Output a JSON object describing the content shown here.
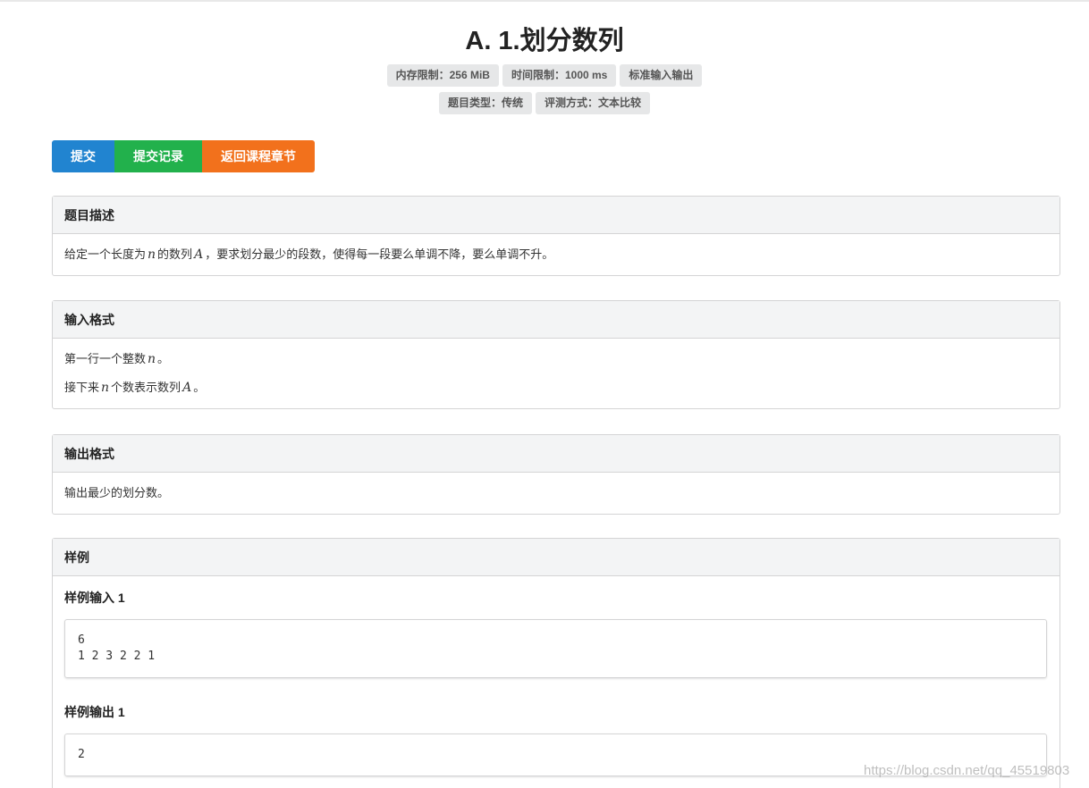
{
  "title": "A. 1.划分数列",
  "tags": {
    "memory": "内存限制：256 MiB",
    "time": "时间限制：1000 ms",
    "io": "标准输入输出",
    "type": "题目类型：传统",
    "judge": "评测方式：文本比较"
  },
  "buttons": {
    "submit": "提交",
    "records": "提交记录",
    "back": "返回课程章节"
  },
  "description": {
    "heading": "题目描述",
    "text_1": "给定一个长度为",
    "var_n": "n",
    "text_2": "的数列",
    "var_A": "A",
    "text_3": "，要求划分最少的段数，使得每一段要么单调不降，要么单调不升。"
  },
  "input_format": {
    "heading": "输入格式",
    "line1_text": "第一行一个整数",
    "line1_var": "n",
    "line1_end": "。",
    "line2_text_1": "接下来",
    "line2_var_n": "n",
    "line2_text_2": "个数表示数列",
    "line2_var_A": "A",
    "line2_end": "。"
  },
  "output_format": {
    "heading": "输出格式",
    "text": "输出最少的划分数。"
  },
  "samples": {
    "heading": "样例",
    "input_title": "样例输入 1",
    "input_code": "6\n1 2 3 2 2 1",
    "output_title": "样例输出 1",
    "output_code": "2"
  },
  "watermark": "https://blog.csdn.net/qq_45519803"
}
